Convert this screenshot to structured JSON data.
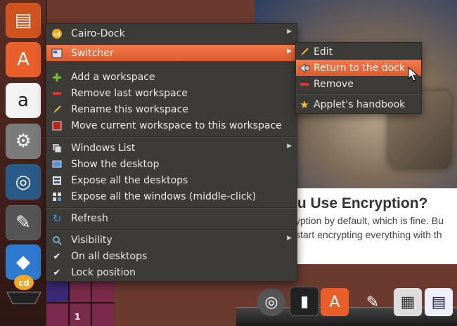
{
  "menu": {
    "items": [
      {
        "label": "Cairo-Dock",
        "icon": "cairo-dock-icon",
        "submenu": true
      },
      {
        "label": "Switcher",
        "icon": "switcher-icon",
        "submenu": true,
        "highlighted": true
      },
      {
        "label": "Add a workspace",
        "icon": "add-icon"
      },
      {
        "label": "Remove last workspace",
        "icon": "remove-icon"
      },
      {
        "label": "Rename this workspace",
        "icon": "pencil-icon"
      },
      {
        "label": "Move current workspace to this workspace",
        "icon": "move-icon"
      },
      {
        "label": "Windows List",
        "icon": "windows-list-icon",
        "submenu": true
      },
      {
        "label": "Show the desktop",
        "icon": "show-desktop-icon"
      },
      {
        "label": "Expose all the desktops",
        "icon": "expose-desktops-icon"
      },
      {
        "label": "Expose all the windows (middle-click)",
        "icon": "expose-windows-icon"
      },
      {
        "label": "Refresh",
        "icon": "refresh-icon"
      },
      {
        "label": "Visibility",
        "icon": "visibility-icon",
        "submenu": true
      },
      {
        "label": "On all desktops",
        "icon": "check-icon"
      },
      {
        "label": "Lock position",
        "icon": "check-icon"
      }
    ]
  },
  "submenu": {
    "items": [
      {
        "label": "Edit",
        "icon": "pencil-icon"
      },
      {
        "label": "Return to the dock",
        "icon": "return-icon",
        "highlighted": true
      },
      {
        "label": "Remove",
        "icon": "remove-icon"
      },
      {
        "label": "Applet's handbook",
        "icon": "star-icon"
      }
    ]
  },
  "article": {
    "title": "ou Use Encryption?",
    "lines": [
      "yption by default, which is fine. Bu",
      "start encrypting everything with th"
    ]
  },
  "switcher": {
    "workspace_number": "1"
  },
  "colors": {
    "highlight": "#f0683a",
    "menu_bg": "#3c3b37"
  }
}
